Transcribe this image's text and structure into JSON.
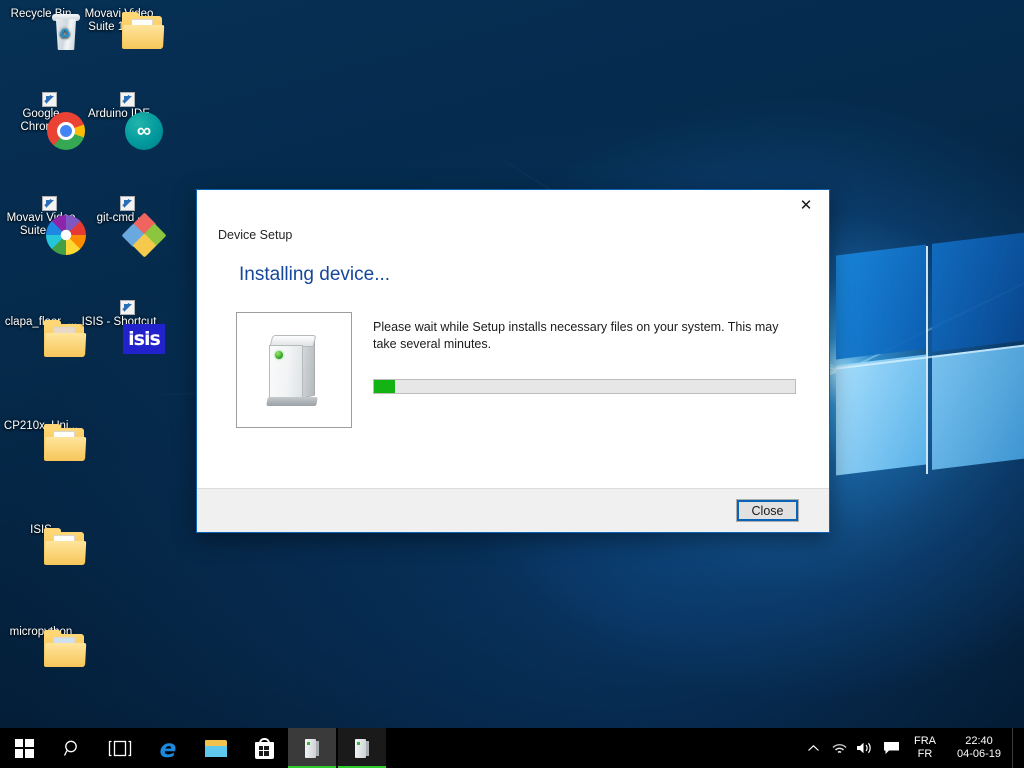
{
  "desktop": {
    "icons": [
      {
        "name": "recycle-bin",
        "label": "Recycle Bin",
        "icon": "recycle-bin-icon",
        "shortcut": false
      },
      {
        "name": "movavi-suite-1702",
        "label": "Movavi Video Suite 17.0.2",
        "icon": "folder-icon",
        "shortcut": false
      },
      {
        "name": "google-chrome",
        "label": "Google Chrome",
        "icon": "chrome-icon",
        "shortcut": true
      },
      {
        "name": "arduino-ide",
        "label": "Arduino IDE",
        "icon": "arduino-icon",
        "shortcut": true
      },
      {
        "name": "movavi-suite-17",
        "label": "Movavi Video Suite 17",
        "icon": "movavi-pinwheel-icon",
        "shortcut": true
      },
      {
        "name": "git-cmd",
        "label": "git-cmd -",
        "icon": "git-cmd-icon",
        "shortcut": true
      },
      {
        "name": "clapa-floor",
        "label": "clapa_floor_...",
        "icon": "folder-icon",
        "shortcut": false
      },
      {
        "name": "isis-shortcut",
        "label": "ISIS - Shortcut",
        "icon": "isis-icon",
        "shortcut": true
      },
      {
        "name": "cp210x-uni",
        "label": "CP210x_Uni...",
        "icon": "folder-icon",
        "shortcut": false
      },
      {
        "name": "isis-folder",
        "label": "ISIS",
        "icon": "folder-icon",
        "shortcut": false
      },
      {
        "name": "micropython",
        "label": "micropython",
        "icon": "folder-icon",
        "shortcut": false
      }
    ]
  },
  "dialog": {
    "app_title": "Device Setup",
    "close_icon": "close-x-icon",
    "heading": "Installing device...",
    "message": "Please wait while Setup installs necessary files on your system. This may take several minutes.",
    "device_image_icon": "computer-tower-icon",
    "progress": {
      "percent": 5,
      "fill_color": "#12b312",
      "track_color": "#e7e7e7"
    },
    "footer": {
      "close_label": "Close"
    },
    "accent_color": "#0a63b4",
    "heading_color": "#15479b"
  },
  "taskbar": {
    "start_icon": "windows-start-icon",
    "search_icon": "search-icon",
    "taskview_icon": "task-view-icon",
    "pinned": [
      {
        "name": "edge",
        "icon": "edge-icon"
      },
      {
        "name": "file-explorer",
        "icon": "folder-explorer-icon"
      },
      {
        "name": "microsoft-store",
        "icon": "store-bag-icon"
      }
    ],
    "running": [
      {
        "name": "device-setup-window-1",
        "icon": "computer-tower-icon",
        "active": true
      },
      {
        "name": "device-setup-window-2",
        "icon": "computer-tower-icon",
        "active": false
      }
    ],
    "tray": {
      "chevron_icon": "show-hidden-icons-chevron",
      "network_icon": "wifi-icon",
      "volume_icon": "speaker-icon",
      "action_center_icon": "action-center-icon",
      "language_primary": "FRA",
      "language_secondary": "FR",
      "time": "22:40",
      "date": "04-06-19"
    },
    "accent_underline_color": "#2ecc2e"
  }
}
